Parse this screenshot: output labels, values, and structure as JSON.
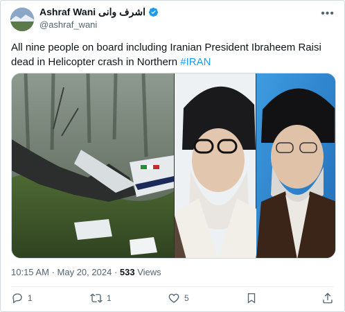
{
  "author": {
    "display_name": "Ashraf Wani اشرف وانی",
    "handle": "@ashraf_wani",
    "verified": true
  },
  "tweet": {
    "text": "All nine people on board including Iranian President Ibraheem Raisi dead in Helicopter crash in Northern ",
    "hashtag": "#IRAN"
  },
  "meta": {
    "time": "10:15 AM",
    "separator": "·",
    "date": "May 20, 2024",
    "views_count": "533",
    "views_label": "Views"
  },
  "actions": {
    "replies": "1",
    "reposts": "1",
    "likes": "5"
  },
  "colors": {
    "accent": "#1d9bf0",
    "muted": "#536471",
    "text": "#0f1419"
  }
}
